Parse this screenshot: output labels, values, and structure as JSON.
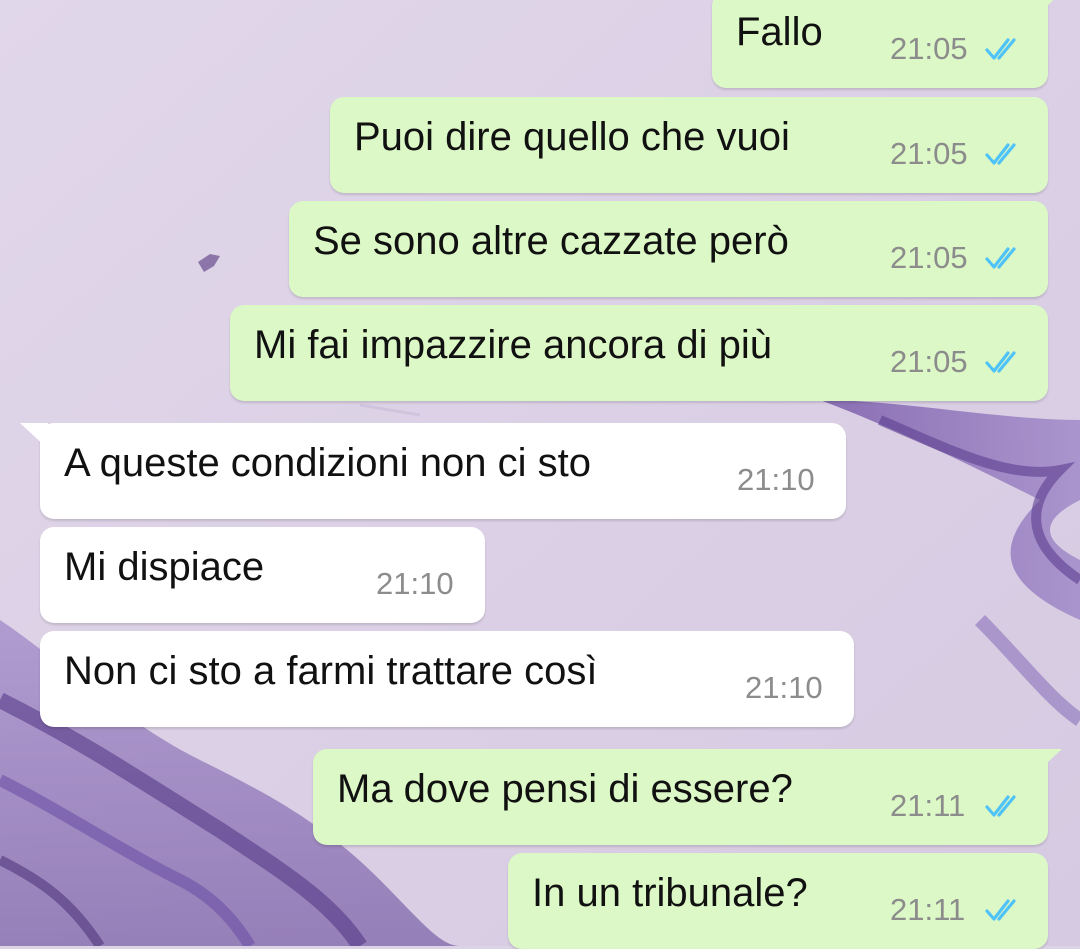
{
  "colors": {
    "outgoing_bubble": "#dcf8c6",
    "incoming_bubble": "#ffffff",
    "read_ticks": "#4fc3f7",
    "timestamp": "#8c8c8c",
    "wallpaper": "#ddd3e6"
  },
  "messages": [
    {
      "direction": "out",
      "text": "Fallo",
      "time": "21:05",
      "status": "read"
    },
    {
      "direction": "out",
      "text": "Puoi dire quello che vuoi",
      "time": "21:05",
      "status": "read"
    },
    {
      "direction": "out",
      "text": "Se sono altre cazzate però",
      "time": "21:05",
      "status": "read"
    },
    {
      "direction": "out",
      "text": "Mi fai impazzire ancora di più",
      "time": "21:05",
      "status": "read"
    },
    {
      "direction": "in",
      "text": "A queste condizioni non ci sto",
      "time": "21:10"
    },
    {
      "direction": "in",
      "text": "Mi dispiace",
      "time": "21:10"
    },
    {
      "direction": "in",
      "text": "Non ci sto a farmi trattare così",
      "time": "21:10"
    },
    {
      "direction": "out",
      "text": "Ma dove pensi di essere?",
      "time": "21:11",
      "status": "read"
    },
    {
      "direction": "out",
      "text": "In un tribunale?",
      "time": "21:11",
      "status": "read"
    }
  ],
  "icons": {
    "read_status": "double-check-icon"
  }
}
